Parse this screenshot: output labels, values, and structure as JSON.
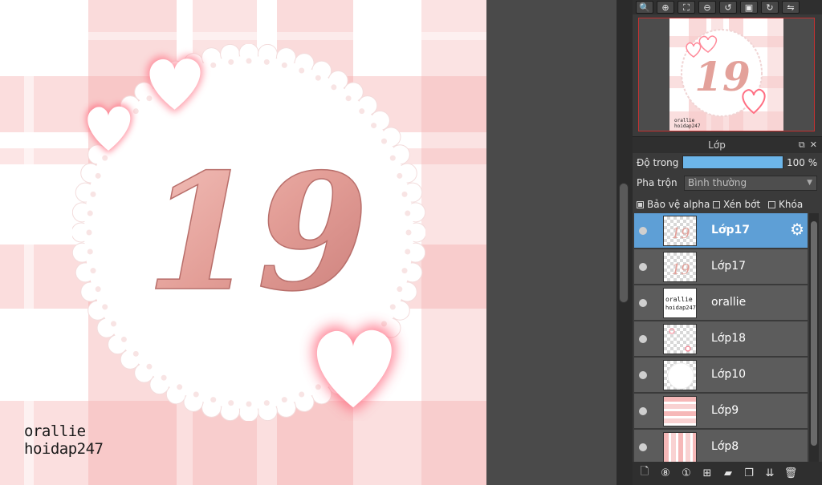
{
  "canvas": {
    "big_number": "19",
    "watermark_line1": "orallie",
    "watermark_line2": "hoidap247"
  },
  "navigator_toolbar": {
    "icons": [
      "zoom-reset-icon",
      "zoom-in-icon",
      "fit-icon",
      "zoom-out-icon",
      "rotate-left-icon",
      "fullscreen-icon",
      "rotate-right-icon",
      "flip-icon"
    ]
  },
  "navigator": {
    "preview_number": "19",
    "preview_watermark1": "orallie",
    "preview_watermark2": "hoidap247"
  },
  "layer_panel": {
    "title": "Lớp",
    "opacity_label": "Độ trong",
    "opacity_value": "100 %",
    "opacity_fraction": 1.0,
    "blend_label": "Pha trộn",
    "blend_value": "Bình thường",
    "option_alpha": "Bảo vệ alpha",
    "option_clip": "Xén bớt",
    "option_lock": "Khóa",
    "alpha_checked": true,
    "clip_checked": false,
    "lock_checked": false
  },
  "layers": [
    {
      "name": "Lớp17",
      "selected": true,
      "thumb": "number"
    },
    {
      "name": "Lớp17",
      "selected": false,
      "thumb": "number"
    },
    {
      "name": "orallie",
      "selected": false,
      "thumb": "text",
      "thumb_text1": "orallie",
      "thumb_text2": "hoidap247"
    },
    {
      "name": "Lớp18",
      "selected": false,
      "thumb": "hearts"
    },
    {
      "name": "Lớp10",
      "selected": false,
      "thumb": "circle"
    },
    {
      "name": "Lớp9",
      "selected": false,
      "thumb": "hstripes"
    },
    {
      "name": "Lớp8",
      "selected": false,
      "thumb": "vstripes"
    }
  ],
  "colors": {
    "accent_selected": "#5e9fd6",
    "opacity_bar": "#6cb6ea",
    "navigator_border": "#c43232",
    "plaid_pink": "#f6c6c6",
    "number_pink": "#e8a6a0"
  }
}
